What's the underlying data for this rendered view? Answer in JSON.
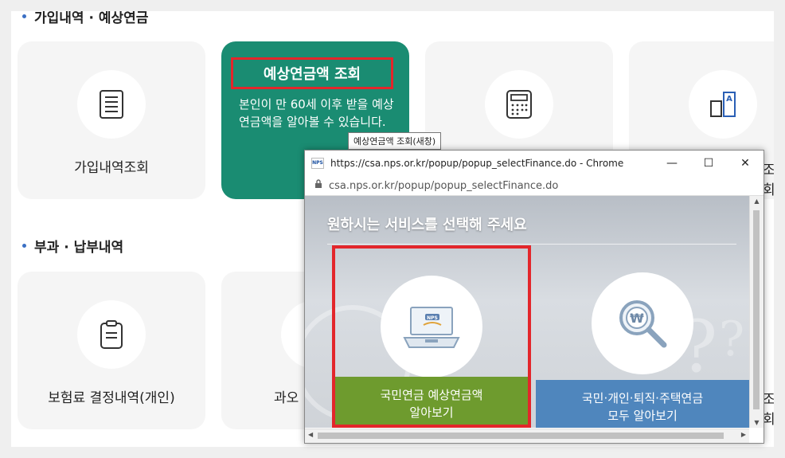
{
  "section1": {
    "title": "가입내역 · 예상연금"
  },
  "section2": {
    "title": "부과 · 납부내역"
  },
  "cards_row1": [
    {
      "label": "가입내역조회",
      "icon": "document-icon"
    },
    {
      "title": "예상연금액 조회",
      "description": "본인이 만 60세 이후 받을 예상연금액을 알아볼 수 있습니다."
    },
    {
      "label": "",
      "icon": "calculator-icon"
    },
    {
      "label": "",
      "icon": "document-a-icon"
    }
  ],
  "cards_row2": [
    {
      "label": "보험료 결정내역(개인)",
      "icon": "clipboard-icon"
    },
    {
      "label": "과오"
    }
  ],
  "edge_text": {
    "right_top": "조회",
    "right_bottom": "조회"
  },
  "tooltip": "예상연금액 조회(새창)",
  "popup": {
    "window_title": "https://csa.nps.or.kr/popup/popup_selectFinance.do - Chrome",
    "address": "csa.nps.or.kr/popup/popup_selectFinance.do",
    "favicon": "NPS",
    "heading": "원하시는 서비스를 선택해 주세요",
    "option1": {
      "line1": "국민연금 예상연금액",
      "line2": "알아보기",
      "badge": "NPS"
    },
    "option2": {
      "line1": "국민·개인·퇴직·주택연금",
      "line2": "모두 알아보기",
      "symbol": "₩"
    },
    "controls": {
      "minimize": "—",
      "maximize": "☐",
      "close": "✕"
    }
  },
  "colors": {
    "card_green": "#1a8c72",
    "highlight_red": "#e3262b",
    "option1_green": "#6e9b2e",
    "option2_blue": "#4f86bd"
  }
}
